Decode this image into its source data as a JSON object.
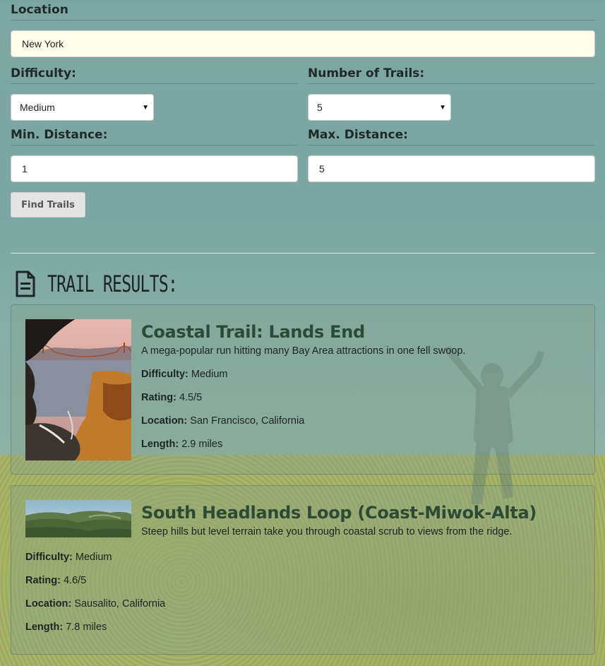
{
  "form": {
    "location_label": "Location",
    "location_value": "New York",
    "difficulty_label": "Difficulty:",
    "difficulty_value": "Medium",
    "num_trails_label": "Number of Trails:",
    "num_trails_value": "5",
    "min_dist_label": "Min. Distance:",
    "min_dist_value": "1",
    "max_dist_label": "Max. Distance:",
    "max_dist_value": "5",
    "find_button": "Find Trails"
  },
  "results": {
    "heading": "Trail Results:",
    "icon": "document-icon",
    "trails": [
      {
        "name": "Coastal Trail: Lands End",
        "summary": "A mega-popular run hitting many Bay Area attractions in one fell swoop.",
        "difficulty_label": "Difficulty:",
        "difficulty": "Medium",
        "rating_label": "Rating:",
        "rating": "4.5/5",
        "location_label": "Location:",
        "location": "San Francisco, California",
        "length_label": "Length:",
        "length": "2.9 miles"
      },
      {
        "name": "South Headlands Loop (Coast-Miwok-Alta)",
        "summary": "Steep hills but level terrain take you through coastal scrub to views from the ridge.",
        "difficulty_label": "Difficulty:",
        "difficulty": "Medium",
        "rating_label": "Rating:",
        "rating": "4.6/5",
        "location_label": "Location:",
        "location": "Sausalito, California",
        "length_label": "Length:",
        "length": "7.8 miles"
      }
    ]
  },
  "colors": {
    "background": "#7aa6a2",
    "title_green": "#2c4a35",
    "input_highlight": "#fdfdea"
  }
}
